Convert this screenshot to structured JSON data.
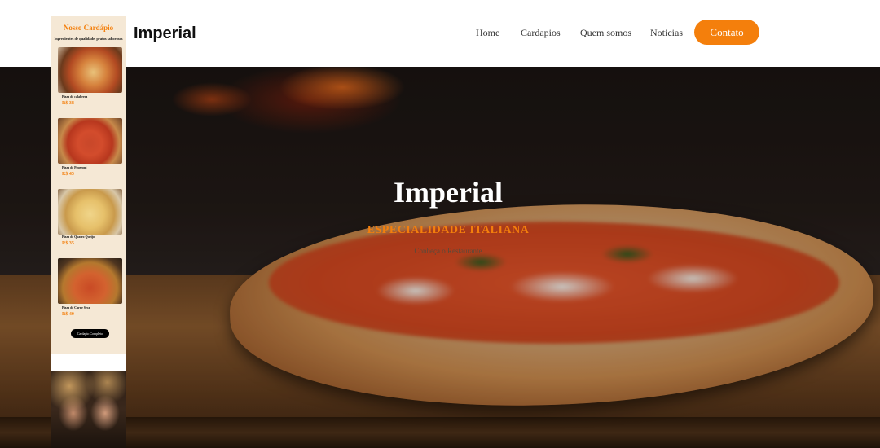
{
  "header": {
    "logo": "Imperial",
    "nav": [
      "Home",
      "Cardapios",
      "Quem somos",
      "Noticias"
    ],
    "contact_label": "Contato"
  },
  "hero": {
    "title": "Imperial",
    "subtitle": "ESPECIALIDADE ITALIANA",
    "description": "Conheça o Restaurante"
  },
  "menu_panel": {
    "title": "Nosso Cardápio",
    "tagline": "Ingredientes de qualidade, pratos saborosos",
    "items": [
      {
        "name": "Pizza de calabresa",
        "price": "R$ 38"
      },
      {
        "name": "Pizza de Peperoni",
        "price": "R$ 45"
      },
      {
        "name": "Pizza de Quatro Queijo",
        "price": "R$ 35"
      },
      {
        "name": "Pizza de Carne Seca",
        "price": "R$ 40"
      }
    ],
    "button_label": "Cardapio Completo"
  },
  "colors": {
    "accent": "#f47f0c",
    "panel_bg": "#f5e8d5"
  }
}
